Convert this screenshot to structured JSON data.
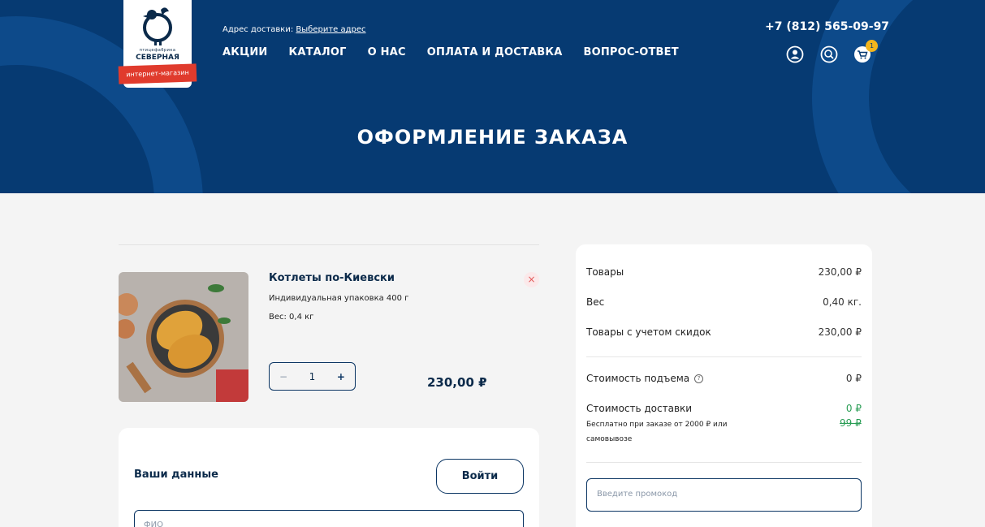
{
  "header": {
    "logo": {
      "line1": "птицефабрика",
      "line2": "СЕВЕРНАЯ",
      "ribbon": "интернет-магазин"
    },
    "address_label": "Адрес доставки:",
    "address_link": "Выберите адрес",
    "nav": [
      "АКЦИИ",
      "КАТАЛОГ",
      "О НАС",
      "ОПЛАТА И ДОСТАВКА",
      "ВОПРОС-ОТВЕТ"
    ],
    "phone": "+7 (812) 565-09-97",
    "cart_count": "1",
    "page_title": "ОФОРМЛЕНИЕ ЗАКАЗА"
  },
  "cart": {
    "item": {
      "name": "Котлеты по-Киевски",
      "desc": "Индивидуальная упаковка 400 г",
      "weight": "Вес: 0,4 кг",
      "quantity": "1",
      "minus": "−",
      "plus": "+",
      "remove": "×",
      "price": "230,00 ₽"
    }
  },
  "user_data": {
    "title": "Ваши данные",
    "login_label": "Войти",
    "fio_placeholder": "ФИО"
  },
  "summary": {
    "goods_label": "Товары",
    "goods_value": "230,00 ₽",
    "weight_label": "Вес",
    "weight_value": "0,40 кг.",
    "discount_label": "Товары с учетом скидок",
    "discount_value": "230,00 ₽",
    "lift_label": "Стоимость подъема",
    "lift_help": "?",
    "lift_value": "0 ₽",
    "delivery_label": "Стоимость доставки",
    "delivery_value": "0 ₽",
    "delivery_old": "99 ₽",
    "delivery_note": "Бесплатно при заказе от 2000 ₽ или самовывозе",
    "promo_placeholder": "Введите промокод"
  },
  "colors": {
    "header_bg": "#063a72",
    "accent_red": "#e03b2d",
    "badge": "#f2b51d",
    "green": "#2a9d55"
  }
}
